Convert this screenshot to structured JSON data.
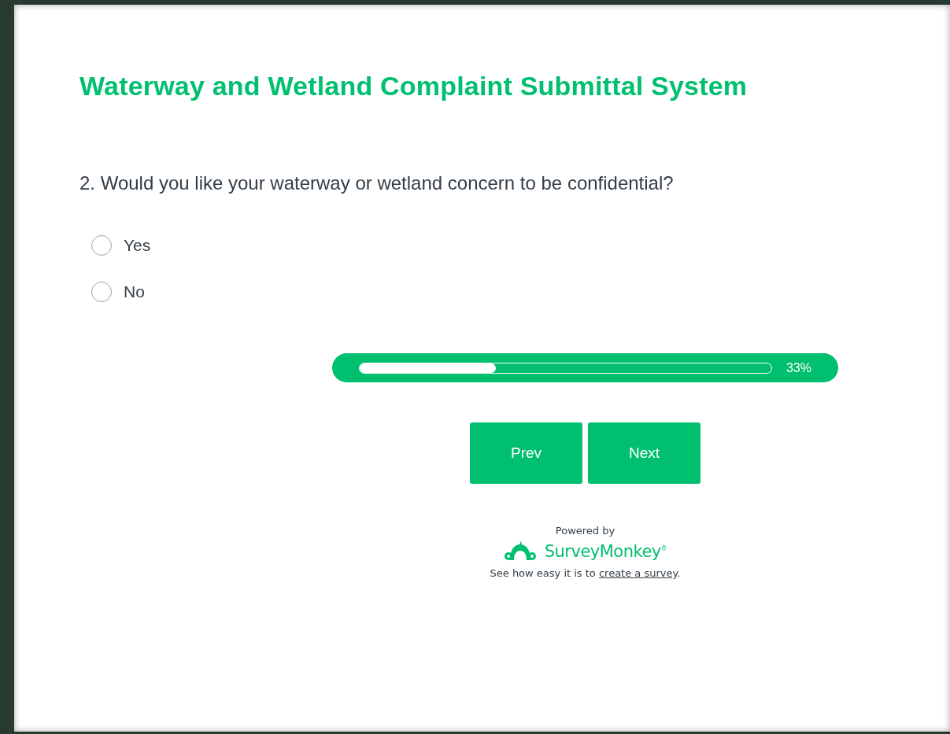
{
  "survey": {
    "title": "Waterway and Wetland Complaint Submittal System"
  },
  "question": {
    "text": "2. Would you like your waterway or wetland concern to be confidential?",
    "options": [
      {
        "label": "Yes",
        "selected": false
      },
      {
        "label": "No",
        "selected": false
      }
    ]
  },
  "progress": {
    "level": 0.33,
    "reading": "33%"
  },
  "buttons": [
    "Prev",
    "Next"
  ],
  "footer": {
    "powered_by": "Powered by",
    "brand": "SurveyMonkey$^{®}$",
    "tagline": "See how easy it is to ",
    "link": "create a survey",
    "tagline_end": "."
  }
}
